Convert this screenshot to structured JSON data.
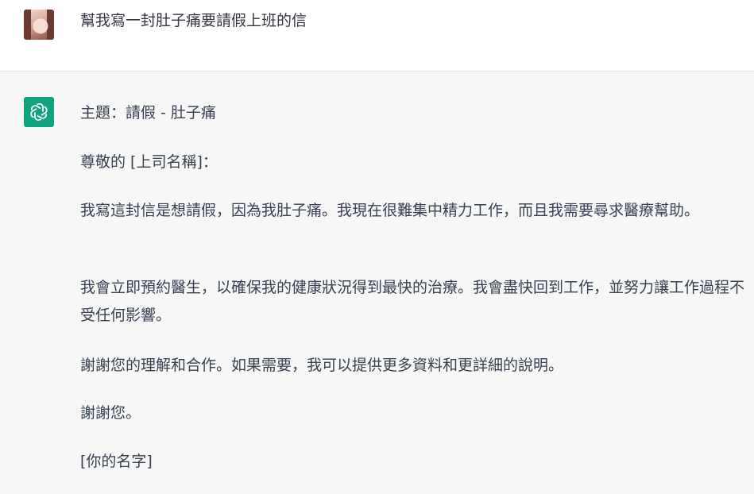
{
  "user_message": {
    "text": "幫我寫一封肚子痛要請假上班的信"
  },
  "assistant_message": {
    "subject": "主題：請假 - 肚子痛",
    "greeting": "尊敬的 [上司名稱]：",
    "body1": "我寫這封信是想請假，因為我肚子痛。我現在很難集中精力工作，而且我需要尋求醫療幫助。",
    "body2": "我會立即預約醫生，以確保我的健康狀況得到最快的治療。我會盡快回到工作，並努力讓工作過程不受任何影響。",
    "thanks": "謝謝您的理解和合作。如果需要，我可以提供更多資料和更詳細的說明。",
    "closing": "謝謝您。",
    "signature": "[你的名字]"
  },
  "colors": {
    "assistant_bg": "#f7f7f8",
    "assistant_icon_bg": "#10a37f",
    "text": "#374151"
  },
  "icons": {
    "user_avatar": "user-photo-avatar",
    "assistant_avatar": "openai-logo-icon"
  }
}
